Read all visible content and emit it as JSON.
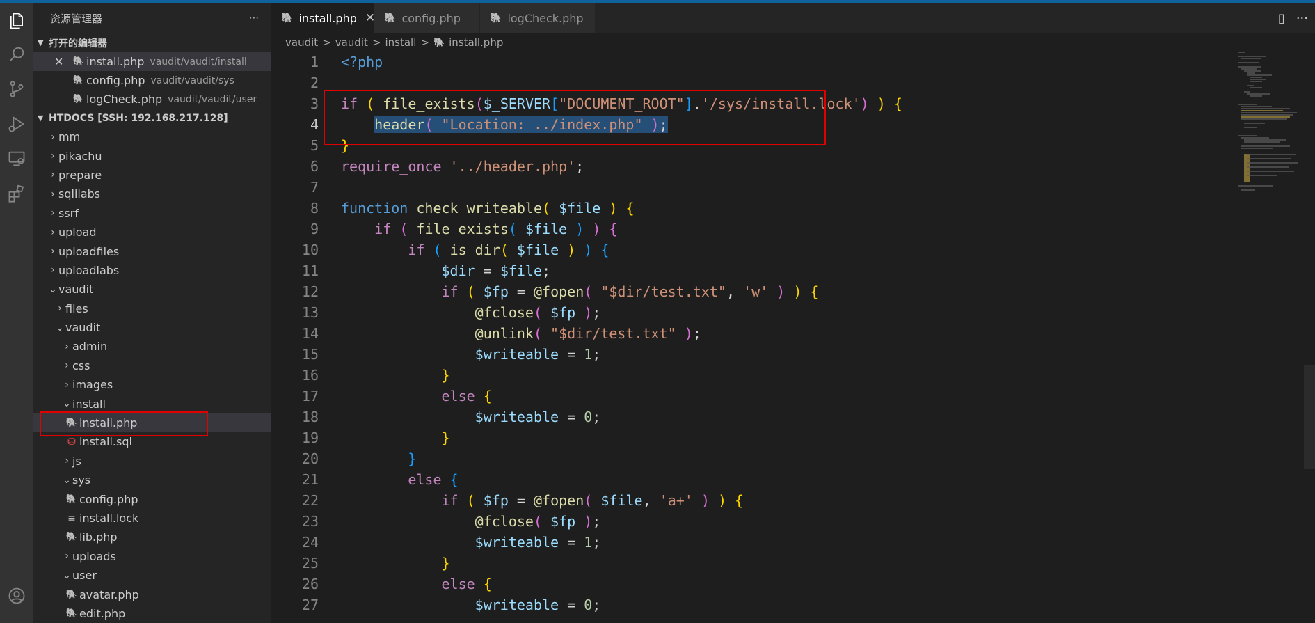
{
  "sidebar": {
    "title": "资源管理器",
    "more": "···",
    "open_editors_title": "打开的编辑器",
    "open_editors": [
      {
        "name": "install.php",
        "path": "vaudit/vaudit/install",
        "close": "✕"
      },
      {
        "name": "config.php",
        "path": "vaudit/vaudit/sys"
      },
      {
        "name": "logCheck.php",
        "path": "vaudit/vaudit/user"
      }
    ],
    "workspace_title": "HTDOCS [SSH: 192.168.217.128]",
    "tree": [
      {
        "label": "mm"
      },
      {
        "label": "pikachu"
      },
      {
        "label": "prepare"
      },
      {
        "label": "sqlilabs"
      },
      {
        "label": "ssrf"
      },
      {
        "label": "upload"
      },
      {
        "label": "uploadfiles"
      },
      {
        "label": "uploadlabs"
      },
      {
        "label": "vaudit"
      },
      {
        "label": "files"
      },
      {
        "label": "vaudit"
      },
      {
        "label": "admin"
      },
      {
        "label": "css"
      },
      {
        "label": "images"
      },
      {
        "label": "install"
      },
      {
        "label": "install.php"
      },
      {
        "label": "install.sql"
      },
      {
        "label": "js"
      },
      {
        "label": "sys"
      },
      {
        "label": "config.php"
      },
      {
        "label": "install.lock"
      },
      {
        "label": "lib.php"
      },
      {
        "label": "uploads"
      },
      {
        "label": "user"
      },
      {
        "label": "avatar.php"
      },
      {
        "label": "edit.php"
      }
    ]
  },
  "tabs": [
    {
      "label": "install.php",
      "close": "✕"
    },
    {
      "label": "config.php"
    },
    {
      "label": "logCheck.php"
    }
  ],
  "tab_actions": {
    "split": "▯",
    "more": "···"
  },
  "breadcrumb": [
    "vaudit",
    "vaudit",
    "install",
    "install.php"
  ],
  "breadcrumb_sep": ">",
  "code": {
    "line_numbers": [
      "1",
      "2",
      "3",
      "4",
      "5",
      "6",
      "7",
      "8",
      "9",
      "10",
      "11",
      "12",
      "13",
      "14",
      "15",
      "16",
      "17",
      "18",
      "19",
      "20",
      "21",
      "22",
      "23",
      "24",
      "25",
      "26",
      "27"
    ],
    "t": {
      "l1": "<?php",
      "if": "if",
      "else": "else",
      "lp": "(",
      "rp": ")",
      "lb": "[",
      "rb": "]",
      "lc": "{",
      "rc": "}",
      "semi": ";",
      "dot": ".",
      "comma": ",",
      "eq": "=",
      "file_exists": "file_exists",
      "server": "$_SERVER",
      "docroot": "\"DOCUMENT_ROOT\"",
      "lockpath": "'/sys/install.lock'",
      "header": "header",
      "location": "\"Location: ../index.php\"",
      "require_once": "require_once",
      "header_php": "'../header.php'",
      "function": "function",
      "check_writeable": "check_writeable",
      "file": "$file",
      "is_dir": "is_dir",
      "dir": "$dir",
      "fp": "$fp",
      "fopen": "@fopen",
      "fclose": "@fclose",
      "unlink": "@unlink",
      "testtxt": "\"$dir/test.txt\"",
      "w": "'w'",
      "aplus": "'a+'",
      "writeable": "$writeable",
      "one": "1",
      "zero": "0"
    }
  }
}
